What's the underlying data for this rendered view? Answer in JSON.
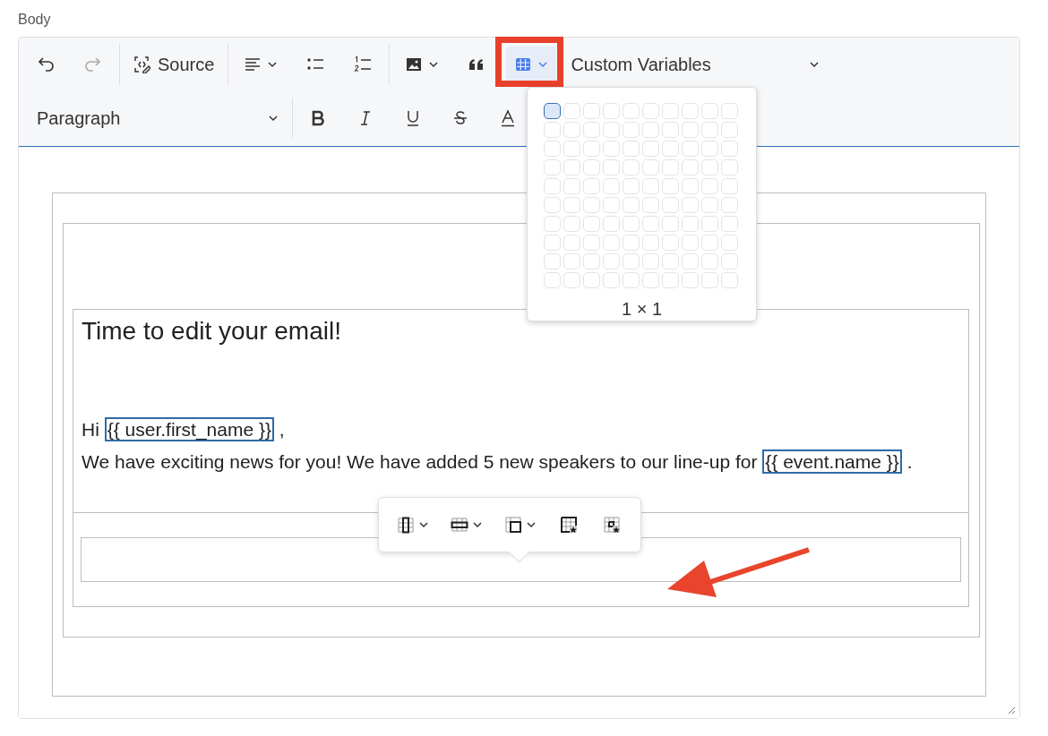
{
  "field_label": "Body",
  "toolbar": {
    "undo": {
      "disabled": false
    },
    "redo": {
      "disabled": true
    },
    "source_button": {
      "label": "Source"
    },
    "table_button": {
      "expanded": true
    },
    "custom_variables": {
      "label": "Custom Variables"
    },
    "heading_dropdown": {
      "value": "Paragraph"
    }
  },
  "table_picker": {
    "size_label": "1 × 1",
    "rows": [
      {
        "cells": [
          {
            "selected": true
          },
          {
            "selected": false
          },
          {
            "selected": false
          },
          {
            "selected": false
          },
          {
            "selected": false
          },
          {
            "selected": false
          },
          {
            "selected": false
          },
          {
            "selected": false
          },
          {
            "selected": false
          },
          {
            "selected": false
          }
        ]
      },
      {
        "cells": [
          {
            "selected": false
          },
          {
            "selected": false
          },
          {
            "selected": false
          },
          {
            "selected": false
          },
          {
            "selected": false
          },
          {
            "selected": false
          },
          {
            "selected": false
          },
          {
            "selected": false
          },
          {
            "selected": false
          },
          {
            "selected": false
          }
        ]
      },
      {
        "cells": [
          {
            "selected": false
          },
          {
            "selected": false
          },
          {
            "selected": false
          },
          {
            "selected": false
          },
          {
            "selected": false
          },
          {
            "selected": false
          },
          {
            "selected": false
          },
          {
            "selected": false
          },
          {
            "selected": false
          },
          {
            "selected": false
          }
        ]
      },
      {
        "cells": [
          {
            "selected": false
          },
          {
            "selected": false
          },
          {
            "selected": false
          },
          {
            "selected": false
          },
          {
            "selected": false
          },
          {
            "selected": false
          },
          {
            "selected": false
          },
          {
            "selected": false
          },
          {
            "selected": false
          },
          {
            "selected": false
          }
        ]
      },
      {
        "cells": [
          {
            "selected": false
          },
          {
            "selected": false
          },
          {
            "selected": false
          },
          {
            "selected": false
          },
          {
            "selected": false
          },
          {
            "selected": false
          },
          {
            "selected": false
          },
          {
            "selected": false
          },
          {
            "selected": false
          },
          {
            "selected": false
          }
        ]
      },
      {
        "cells": [
          {
            "selected": false
          },
          {
            "selected": false
          },
          {
            "selected": false
          },
          {
            "selected": false
          },
          {
            "selected": false
          },
          {
            "selected": false
          },
          {
            "selected": false
          },
          {
            "selected": false
          },
          {
            "selected": false
          },
          {
            "selected": false
          }
        ]
      },
      {
        "cells": [
          {
            "selected": false
          },
          {
            "selected": false
          },
          {
            "selected": false
          },
          {
            "selected": false
          },
          {
            "selected": false
          },
          {
            "selected": false
          },
          {
            "selected": false
          },
          {
            "selected": false
          },
          {
            "selected": false
          },
          {
            "selected": false
          }
        ]
      },
      {
        "cells": [
          {
            "selected": false
          },
          {
            "selected": false
          },
          {
            "selected": false
          },
          {
            "selected": false
          },
          {
            "selected": false
          },
          {
            "selected": false
          },
          {
            "selected": false
          },
          {
            "selected": false
          },
          {
            "selected": false
          },
          {
            "selected": false
          }
        ]
      },
      {
        "cells": [
          {
            "selected": false
          },
          {
            "selected": false
          },
          {
            "selected": false
          },
          {
            "selected": false
          },
          {
            "selected": false
          },
          {
            "selected": false
          },
          {
            "selected": false
          },
          {
            "selected": false
          },
          {
            "selected": false
          },
          {
            "selected": false
          }
        ]
      },
      {
        "cells": [
          {
            "selected": false
          },
          {
            "selected": false
          },
          {
            "selected": false
          },
          {
            "selected": false
          },
          {
            "selected": false
          },
          {
            "selected": false
          },
          {
            "selected": false
          },
          {
            "selected": false
          },
          {
            "selected": false
          },
          {
            "selected": false
          }
        ]
      }
    ]
  },
  "content": {
    "heading": "Time to edit your email!",
    "paragraphs": [
      {
        "parts": [
          {
            "kind": "text",
            "text": "Hi "
          },
          {
            "kind": "variable",
            "text": "{{ user.first_name }}"
          },
          {
            "kind": "text",
            "text": " ,"
          }
        ]
      },
      {
        "parts": [
          {
            "kind": "text",
            "text": "We have exciting news for you! We have added 5 new speakers to our line-up for "
          },
          {
            "kind": "variable",
            "text": "{{ event.name }}"
          },
          {
            "kind": "text",
            "text": " ."
          }
        ]
      }
    ]
  }
}
